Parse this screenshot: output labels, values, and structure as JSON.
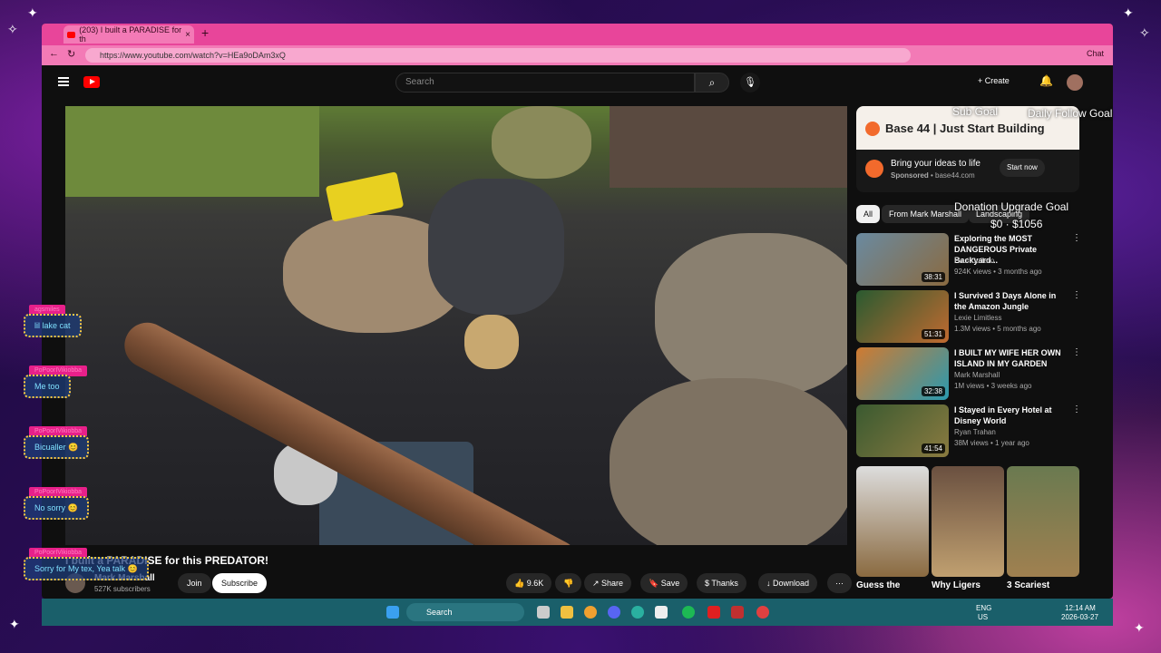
{
  "browser": {
    "tab_title": "(203) I built a PARADISE for th",
    "url": "https://www.youtube.com/watch?v=HEa9oDAm3xQ",
    "chat_label": "Chat"
  },
  "youtube": {
    "search_placeholder": "Search",
    "create_label": "Create",
    "video": {
      "title": "I built a PARADISE for this PREDATOR!",
      "channel": "Mark Marshall",
      "subscribers": "527K subscribers",
      "join_label": "Join",
      "subscribe_label": "Subscribe",
      "likes": "9.6K",
      "share_label": "Share",
      "save_label": "Save",
      "thanks_label": "Thanks",
      "download_label": "Download"
    },
    "ad": {
      "brand": "Base 44",
      "tagline": "Just Start Building",
      "title": "Bring your ideas to life",
      "sponsored": "Sponsored",
      "domain": "base44.com",
      "cta": "Start now"
    },
    "chips": [
      "All",
      "From Mark Marshall",
      "Landscaping"
    ],
    "recommendations": [
      {
        "title": "Exploring the MOST DANGEROUS Private Backyard...",
        "channel": "Paul Cuffaro",
        "meta": "924K views • 3 months ago",
        "duration": "38:31"
      },
      {
        "title": "I Survived 3 Days Alone in the Amazon Jungle",
        "channel": "Lexie Limitless",
        "meta": "1.3M views • 5 months ago",
        "duration": "51:31"
      },
      {
        "title": "I BUILT MY WIFE HER OWN ISLAND IN MY GARDEN",
        "channel": "Mark Marshall",
        "meta": "1M views • 3 weeks ago",
        "duration": "32:38"
      },
      {
        "title": "I Stayed in Every Hotel at Disney World",
        "channel": "Ryan Trahan",
        "meta": "38M views • 1 year ago",
        "duration": "41:54"
      }
    ],
    "shorts": [
      {
        "title": "Guess the"
      },
      {
        "title": "Why Ligers"
      },
      {
        "title": "3 Scariest"
      }
    ]
  },
  "overlay": {
    "sub_goal": "Sub Goal",
    "follow_goal": "Daily Follow Goal",
    "donation_goal": "Donation Upgrade Goal",
    "donation_amount": "$0 · $1056",
    "chat": [
      {
        "name": "agsmiles",
        "msg": "lil lake cat"
      },
      {
        "name": "PoPoorIVikiobba",
        "msg": "Me too"
      },
      {
        "name": "PoPoorIVikiobba",
        "msg": "Bicualler 😊"
      },
      {
        "name": "PoPoorIVikiobba",
        "msg": "No sorry 😊"
      },
      {
        "name": "PoPoorIVikiobba",
        "msg": "Sorry for My tex, Yea talk 😊"
      }
    ]
  },
  "taskbar": {
    "search_label": "Search",
    "lang_top": "ENG",
    "lang_bottom": "US",
    "time": "12:14 AM",
    "date": "2026-03-27"
  },
  "colors": {
    "browser_pink": "#e8459a",
    "yt_red": "#ff0000",
    "taskbar_teal": "#1a5f6a"
  }
}
